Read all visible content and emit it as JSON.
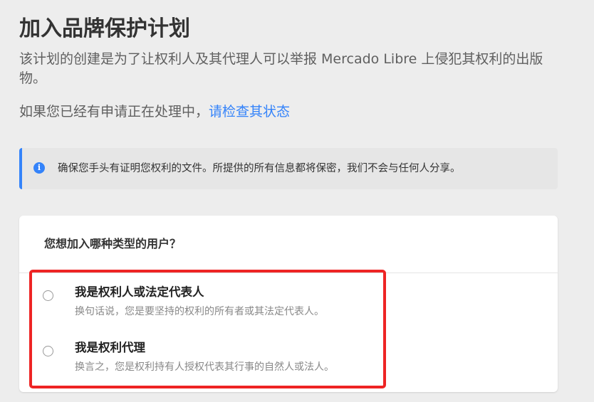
{
  "header": {
    "title": "加入品牌保护计划",
    "intro": "该计划的创建是为了让权利人及其代理人可以举报 Mercado Libre 上侵犯其权利的出版物。",
    "pending_prefix": "如果您已经有申请正在处理中，",
    "pending_link": "请检查其状态"
  },
  "notice": {
    "icon": "info-icon",
    "text": "确保您手头有证明您权利的文件。所提供的所有信息都将保密，我们不会与任何人分享。"
  },
  "user_type": {
    "question": "您想加入哪种类型的用户？",
    "options": [
      {
        "title": "我是权利人或法定代表人",
        "description": "换句话说，您是要坚持的权利的所有者或其法定代表人。",
        "selected": false
      },
      {
        "title": "我是权利代理",
        "description": "换言之，您是权利持有人授权代表其行事的自然人或法人。",
        "selected": false
      }
    ]
  },
  "colors": {
    "accent": "#3483fa",
    "highlight": "#ee2424",
    "background": "#ededed"
  }
}
